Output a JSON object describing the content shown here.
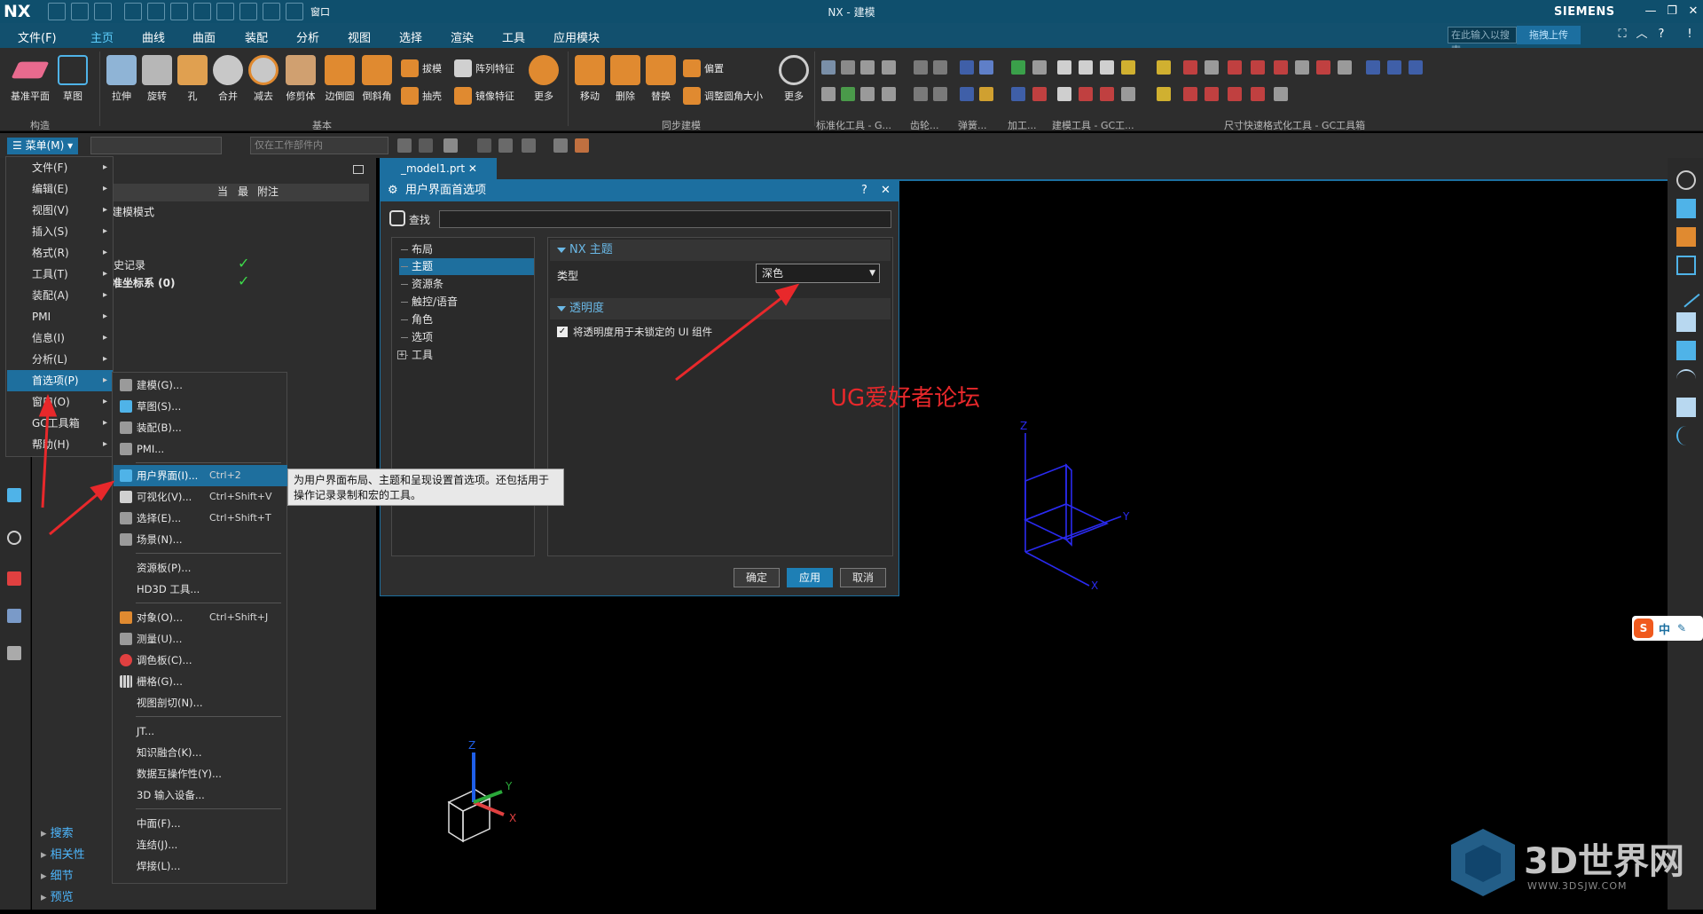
{
  "titlebar": {
    "logo": "NX",
    "window_menu": "窗口",
    "title": "NX - 建模",
    "brand": "SIEMENS"
  },
  "menutabs": [
    "文件(F)",
    "主页",
    "曲线",
    "曲面",
    "装配",
    "分析",
    "视图",
    "选择",
    "渲染",
    "工具",
    "应用模块"
  ],
  "active_tab": "主页",
  "search_placeholder": "在此输入以搜索",
  "upload_label": "拖拽上传",
  "ribbon": {
    "build": [
      {
        "label": "基准平面",
        "icon": "plane-icon",
        "color": "#e86a8e"
      },
      {
        "label": "草图",
        "icon": "sketch-icon",
        "color": "#4fb3e8"
      }
    ],
    "base": [
      {
        "label": "拉伸",
        "icon": "extrude-icon",
        "color": "#8fb4d6"
      },
      {
        "label": "旋转",
        "icon": "revolve-icon",
        "color": "#b7b7b7"
      },
      {
        "label": "孔",
        "icon": "hole-icon",
        "color": "#e0a050"
      },
      {
        "label": "合并",
        "icon": "unite-icon",
        "color": "#c8c8c8"
      },
      {
        "label": "减去",
        "icon": "subtract-icon",
        "color": "#c8c8c8"
      },
      {
        "label": "修剪体",
        "icon": "trim-body-icon",
        "color": "#d0a070"
      },
      {
        "label": "边倒圆",
        "icon": "edge-blend-icon",
        "color": "#e08a30"
      },
      {
        "label": "倒斜角",
        "icon": "chamfer-icon",
        "color": "#e08a30"
      }
    ],
    "base_small": [
      "拔模",
      "阵列特征",
      "抽壳",
      "镜像特征"
    ],
    "base_more": "更多",
    "sync": [
      {
        "label": "移动",
        "icon": "move-face-icon",
        "color": "#e08a30"
      },
      {
        "label": "删除",
        "icon": "delete-face-icon",
        "color": "#e08a30"
      },
      {
        "label": "替换",
        "icon": "replace-face-icon",
        "color": "#e08a30"
      }
    ],
    "sync_small": [
      "偏置",
      "调整圆角大小"
    ],
    "sync_more": "更多",
    "groups": [
      "构造",
      "基本",
      "同步建模",
      "标准化工具 - G...",
      "齿轮...",
      "弹簧...",
      "加工...",
      "建模工具 - GC工...",
      "尺寸快速格式化工具 - GC工具箱"
    ]
  },
  "toolbar2": {
    "menu_button": "菜单(M)",
    "combo1": "",
    "combo2": "仅在工作部件内"
  },
  "nav": {
    "headers": [
      "当",
      "最",
      "附注"
    ],
    "rows": [
      "建模模式",
      "史记录",
      "准坐标系 (0)"
    ],
    "sections": [
      "搜索",
      "相关性",
      "细节",
      "预览"
    ]
  },
  "main_menu": [
    "文件(F)",
    "编辑(E)",
    "视图(V)",
    "插入(S)",
    "格式(R)",
    "工具(T)",
    "装配(A)",
    "PMI",
    "信息(I)",
    "分析(L)",
    "首选项(P)",
    "窗口(O)",
    "GC工具箱",
    "帮助(H)"
  ],
  "main_menu_highlight": 10,
  "submenu": [
    {
      "label": "建模(G)...",
      "sc": "",
      "icon": "modeling-pref-icon",
      "color": "#9a9a9a"
    },
    {
      "label": "草图(S)...",
      "sc": "",
      "icon": "sketch-pref-icon",
      "color": "#4fb3e8"
    },
    {
      "label": "装配(B)...",
      "sc": "",
      "icon": "assembly-pref-icon",
      "color": "#9a9a9a"
    },
    {
      "label": "PMI...",
      "sc": "",
      "icon": "pmi-pref-icon",
      "color": "#9a9a9a"
    },
    {
      "label": "用户界面(I)...",
      "sc": "Ctrl+2",
      "icon": "user-interface-icon",
      "color": "#4fb3e8"
    },
    {
      "label": "可视化(V)...",
      "sc": "Ctrl+Shift+V",
      "icon": "visualization-icon",
      "color": "#d0d0d0"
    },
    {
      "label": "选择(E)...",
      "sc": "Ctrl+Shift+T",
      "icon": "selection-icon",
      "color": "#9a9a9a"
    },
    {
      "label": "场景(N)...",
      "sc": "",
      "icon": "scene-icon",
      "color": "#9a9a9a"
    },
    {
      "label": "资源板(P)...",
      "sc": "",
      "icon": "",
      "color": ""
    },
    {
      "label": "HD3D 工具...",
      "sc": "",
      "icon": "",
      "color": ""
    },
    {
      "label": "对象(O)...",
      "sc": "Ctrl+Shift+J",
      "icon": "object-icon",
      "color": "#e08a30"
    },
    {
      "label": "测量(U)...",
      "sc": "",
      "icon": "measure-icon",
      "color": "#9a9a9a"
    },
    {
      "label": "调色板(C)...",
      "sc": "",
      "icon": "palette-icon",
      "color": "#e04040"
    },
    {
      "label": "栅格(G)...",
      "sc": "",
      "icon": "grid-icon",
      "color": "#d0d0d0"
    },
    {
      "label": "视图剖切(N)...",
      "sc": "",
      "icon": "",
      "color": ""
    },
    {
      "label": "JT...",
      "sc": "",
      "icon": "",
      "color": ""
    },
    {
      "label": "知识融合(K)...",
      "sc": "",
      "icon": "",
      "color": ""
    },
    {
      "label": "数据互操作性(Y)...",
      "sc": "",
      "icon": "",
      "color": ""
    },
    {
      "label": "3D 输入设备...",
      "sc": "",
      "icon": "",
      "color": ""
    },
    {
      "label": "中面(F)...",
      "sc": "",
      "icon": "",
      "color": ""
    },
    {
      "label": "连结(J)...",
      "sc": "",
      "icon": "",
      "color": ""
    },
    {
      "label": "焊接(L)...",
      "sc": "",
      "icon": "",
      "color": ""
    }
  ],
  "submenu_highlight": 4,
  "tooltip": "为用户界面布局、主题和呈现设置首选项。还包括用于操作记录录制和宏的工具。",
  "file_tab": "_model1.prt",
  "dialog": {
    "title": "用户界面首选项",
    "search_label": "查找",
    "tree": [
      "布局",
      "主题",
      "资源条",
      "触控/语音",
      "角色",
      "选项",
      "工具"
    ],
    "tree_selected": 1,
    "group1": "NX 主题",
    "type_label": "类型",
    "type_value": "深色",
    "group2": "透明度",
    "checkbox_label": "将透明度用于未锁定的 UI 组件",
    "checkbox_checked": true,
    "buttons": [
      "确定",
      "应用",
      "取消"
    ]
  },
  "annotation": "UG爱好者论坛",
  "ime": "中",
  "watermark": {
    "title": "3D世界网",
    "url": "WWW.3DSJW.COM"
  },
  "axes": {
    "x": "X",
    "y": "Y",
    "z": "Z"
  }
}
